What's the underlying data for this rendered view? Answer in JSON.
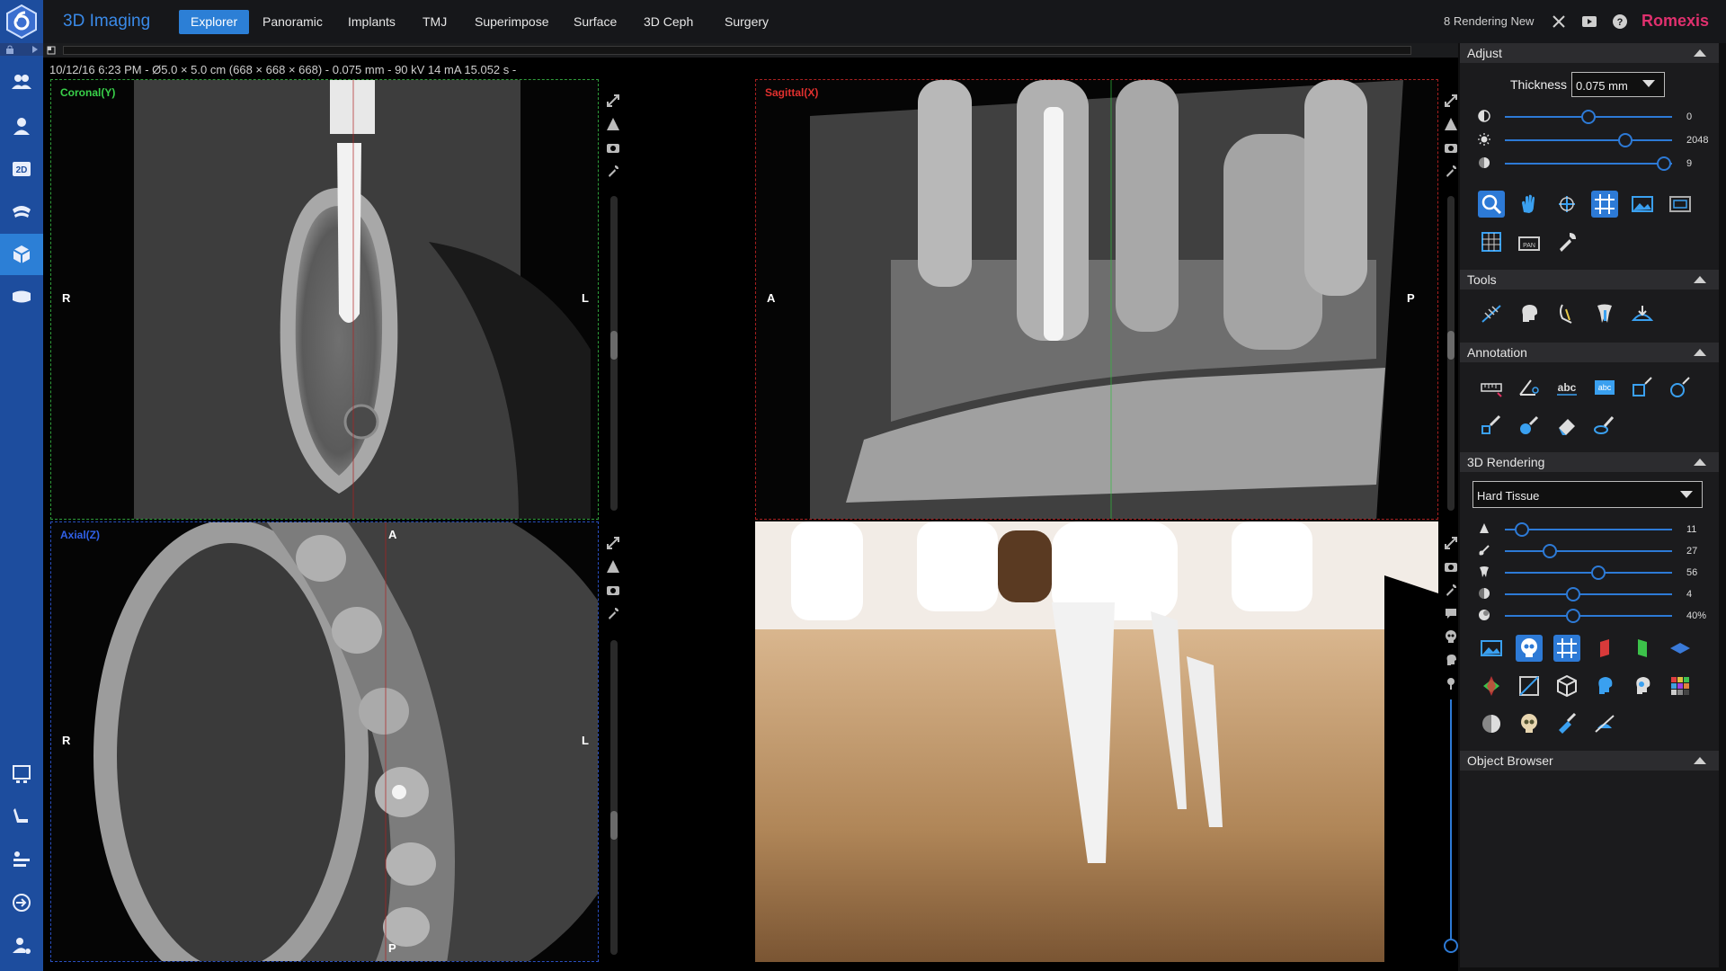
{
  "app": {
    "title": "3D Imaging",
    "brand": "Romexis"
  },
  "tabs": [
    {
      "label": "Explorer",
      "active": true
    },
    {
      "label": "Panoramic"
    },
    {
      "label": "Implants"
    },
    {
      "label": "TMJ"
    },
    {
      "label": "Superimpose"
    },
    {
      "label": "Surface"
    },
    {
      "label": "3D Ceph"
    },
    {
      "label": "Surgery"
    }
  ],
  "topbar": {
    "rendering_status": "8 Rendering New"
  },
  "scan_info": "10/12/16 6:23 PM - Ø5.0 × 5.0 cm (668 × 668 × 668) - 0.075 mm - 90 kV 14 mA 15.052 s -",
  "views": {
    "coronal": {
      "label": "Coronal(Y)",
      "left": "R",
      "right": "L",
      "color": "#39d14a"
    },
    "sagittal": {
      "label": "Sagittal(X)",
      "left": "A",
      "right": "P",
      "color": "#e0302e"
    },
    "axial": {
      "label": "Axial(Z)",
      "left": "R",
      "right": "L",
      "top": "A",
      "bottom": "P",
      "color": "#3060e8"
    }
  },
  "panel": {
    "adjust": {
      "title": "Adjust",
      "thickness_label": "Thickness",
      "thickness_value": "0.075 mm",
      "sliders": [
        {
          "icon": "contrast-icon",
          "value": "0",
          "pos": 0.5
        },
        {
          "icon": "brightness-icon",
          "value": "2048",
          "pos": 0.72
        },
        {
          "icon": "sharpen-icon",
          "value": "9",
          "pos": 0.95
        }
      ]
    },
    "tools": {
      "title": "Tools"
    },
    "annotation": {
      "title": "Annotation"
    },
    "rendering": {
      "title": "3D Rendering",
      "preset": "Hard Tissue",
      "sliders": [
        {
          "icon": "opacity-icon",
          "value": "11",
          "pos": 0.1
        },
        {
          "icon": "threshold-icon",
          "value": "27",
          "pos": 0.27
        },
        {
          "icon": "tooth-icon",
          "value": "56",
          "pos": 0.56
        },
        {
          "icon": "texture-icon",
          "value": "4",
          "pos": 0.41
        },
        {
          "icon": "transparency-icon",
          "value": "40%",
          "pos": 0.41
        }
      ]
    },
    "object_browser": {
      "title": "Object Browser"
    }
  }
}
